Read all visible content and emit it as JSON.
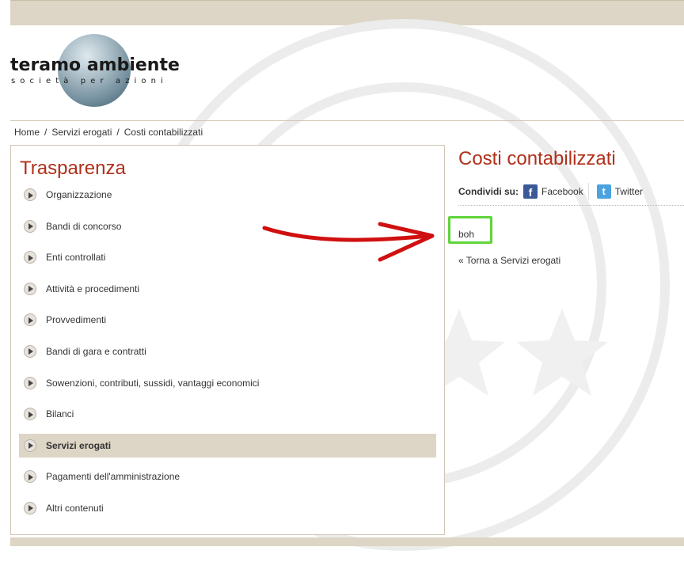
{
  "logo": {
    "title": "teramo ambiente",
    "subtitle": "società per azioni"
  },
  "breadcrumb": {
    "items": [
      "Home",
      "Servizi erogati",
      "Costi contabilizzati"
    ],
    "separator": "/"
  },
  "sidebar": {
    "title": "Trasparenza",
    "items": [
      {
        "label": "Organizzazione"
      },
      {
        "label": "Bandi di concorso"
      },
      {
        "label": "Enti controllati"
      },
      {
        "label": "Attività e procedimenti"
      },
      {
        "label": "Provvedimenti"
      },
      {
        "label": "Bandi di gara e contratti"
      },
      {
        "label": "Sowenzioni, contributi, sussidi, vantaggi economici"
      },
      {
        "label": "Bilanci"
      },
      {
        "label": "Servizi erogati",
        "active": true
      },
      {
        "label": "Pagamenti dell'amministrazione"
      },
      {
        "label": "Altri contenuti"
      }
    ]
  },
  "content": {
    "title": "Costi contabilizzati",
    "share_label": "Condividi su:",
    "facebook": "Facebook",
    "twitter": "Twitter",
    "body": "boh",
    "back_link": "« Torna a Servizi erogati"
  },
  "colors": {
    "accent": "#b0301a",
    "bar": "#ddd5c5",
    "highlight": "#5fd43a",
    "arrow": "#d01010"
  }
}
